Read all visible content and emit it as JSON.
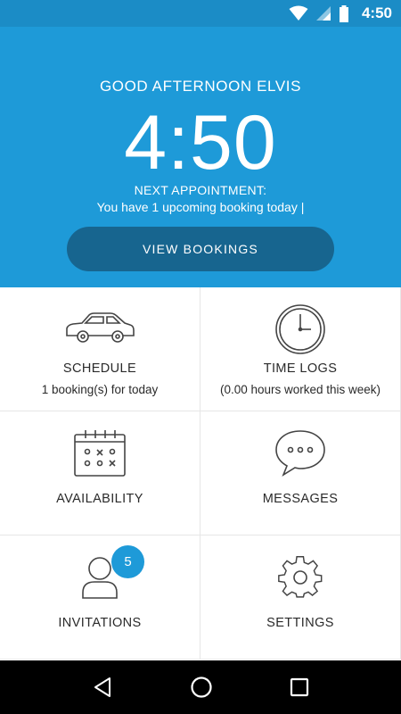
{
  "status_bar": {
    "time": "4:50",
    "icons": [
      "wifi-icon",
      "signal-icon",
      "battery-icon"
    ]
  },
  "hero": {
    "greeting": "GOOD AFTERNOON ELVIS",
    "clock": "4:50",
    "next_label": "NEXT APPOINTMENT:",
    "next_text": "You have 1 upcoming booking today |",
    "button_label": "VIEW BOOKINGS"
  },
  "tiles": [
    {
      "icon": "car-icon",
      "title": "SCHEDULE",
      "subtitle": "1 booking(s) for today"
    },
    {
      "icon": "clock-icon",
      "title": "TIME LOGS",
      "subtitle": "(0.00 hours worked this week)"
    },
    {
      "icon": "calendar-icon",
      "title": "AVAILABILITY",
      "subtitle": ""
    },
    {
      "icon": "chat-icon",
      "title": "MESSAGES",
      "subtitle": ""
    },
    {
      "icon": "person-icon",
      "title": "INVITATIONS",
      "subtitle": "",
      "badge": "5"
    },
    {
      "icon": "gear-icon",
      "title": "SETTINGS",
      "subtitle": ""
    }
  ],
  "nav_bar": {
    "buttons": [
      "back-icon",
      "home-icon",
      "recents-icon"
    ]
  },
  "colors": {
    "primary": "#1e9ad8",
    "status_bar": "#1b8cc6",
    "button": "#17658f",
    "text": "#2a2a2a"
  }
}
